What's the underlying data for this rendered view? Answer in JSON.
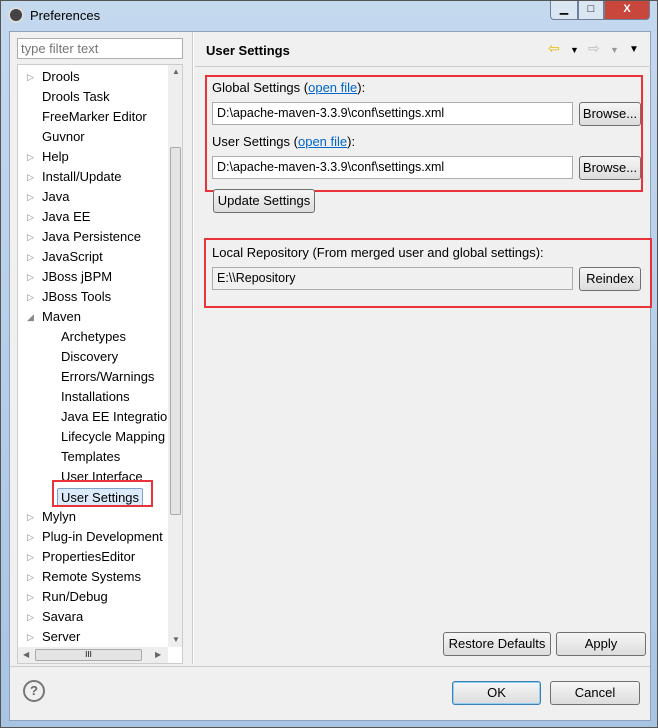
{
  "window": {
    "title": "Preferences",
    "minimize": "▁",
    "maximize": "□",
    "close": "X"
  },
  "filter": {
    "placeholder": "type filter text"
  },
  "tree": {
    "items": [
      {
        "label": "Drools",
        "expandable": true
      },
      {
        "label": "Drools Task"
      },
      {
        "label": "FreeMarker Editor"
      },
      {
        "label": "Guvnor"
      },
      {
        "label": "Help",
        "expandable": true
      },
      {
        "label": "Install/Update",
        "expandable": true
      },
      {
        "label": "Java",
        "expandable": true
      },
      {
        "label": "Java EE",
        "expandable": true
      },
      {
        "label": "Java Persistence",
        "expandable": true
      },
      {
        "label": "JavaScript",
        "expandable": true
      },
      {
        "label": "JBoss jBPM",
        "expandable": true
      },
      {
        "label": "JBoss Tools",
        "expandable": true
      },
      {
        "label": "Maven",
        "expanded": true
      },
      {
        "label": "Archetypes",
        "child": true
      },
      {
        "label": "Discovery",
        "child": true
      },
      {
        "label": "Errors/Warnings",
        "child": true
      },
      {
        "label": "Installations",
        "child": true
      },
      {
        "label": "Java EE Integration",
        "child": true
      },
      {
        "label": "Lifecycle Mapping",
        "child": true
      },
      {
        "label": "Templates",
        "child": true
      },
      {
        "label": "User Interface",
        "child": true
      },
      {
        "label": "User Settings",
        "child": true,
        "selected": true
      },
      {
        "label": "Mylyn",
        "expandable": true
      },
      {
        "label": "Plug-in Development",
        "expandable": true
      },
      {
        "label": "PropertiesEditor",
        "expandable": true
      },
      {
        "label": "Remote Systems",
        "expandable": true
      },
      {
        "label": "Run/Debug",
        "expandable": true
      },
      {
        "label": "Savara",
        "expandable": true
      },
      {
        "label": "Server",
        "expandable": true
      }
    ],
    "hscroll_grip": "III"
  },
  "page": {
    "title": "User Settings",
    "global_label": "Global Settings (",
    "global_link": "open file",
    "global_close": "):",
    "global_value": "D:\\apache-maven-3.3.9\\conf\\settings.xml",
    "user_label": "User Settings (",
    "user_link": "open file",
    "user_close": "):",
    "user_value": "D:\\apache-maven-3.3.9\\conf\\settings.xml",
    "browse": "Browse...",
    "update": "Update Settings",
    "local_label": "Local Repository (From merged user and global settings):",
    "local_value": "E:\\\\Repository",
    "reindex": "Reindex",
    "restore": "Restore Defaults",
    "apply": "Apply"
  },
  "footer": {
    "help": "?",
    "ok": "OK",
    "cancel": "Cancel"
  },
  "colors": {
    "highlight": "#e8333a",
    "link": "#0066cc",
    "selection": "#dcebfc"
  }
}
